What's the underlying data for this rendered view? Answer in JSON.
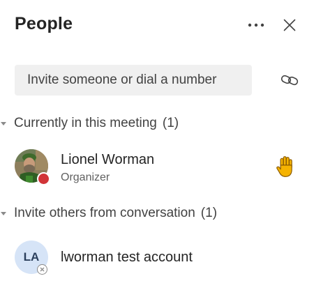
{
  "panel": {
    "title": "People",
    "more_options_icon": "more-horizontal-icon",
    "close_icon": "close-icon"
  },
  "invite": {
    "placeholder": "Invite someone or dial a number",
    "link_icon": "link-icon"
  },
  "sections": [
    {
      "label": "Currently in this meeting",
      "count": "(1)",
      "people": [
        {
          "name": "Lionel Worman",
          "role": "Organizer",
          "presence": "busy",
          "status_icon": "raised-hand-icon",
          "status_color": "#f5b301"
        }
      ]
    },
    {
      "label": "Invite others from conversation",
      "count": "(1)",
      "people": [
        {
          "name": "lworman test account",
          "initials": "LA",
          "presence": "offline"
        }
      ]
    }
  ],
  "colors": {
    "busy": "#d13438",
    "initials_avatar_bg": "#d6e4f7",
    "input_bg": "#f0f0f0"
  }
}
